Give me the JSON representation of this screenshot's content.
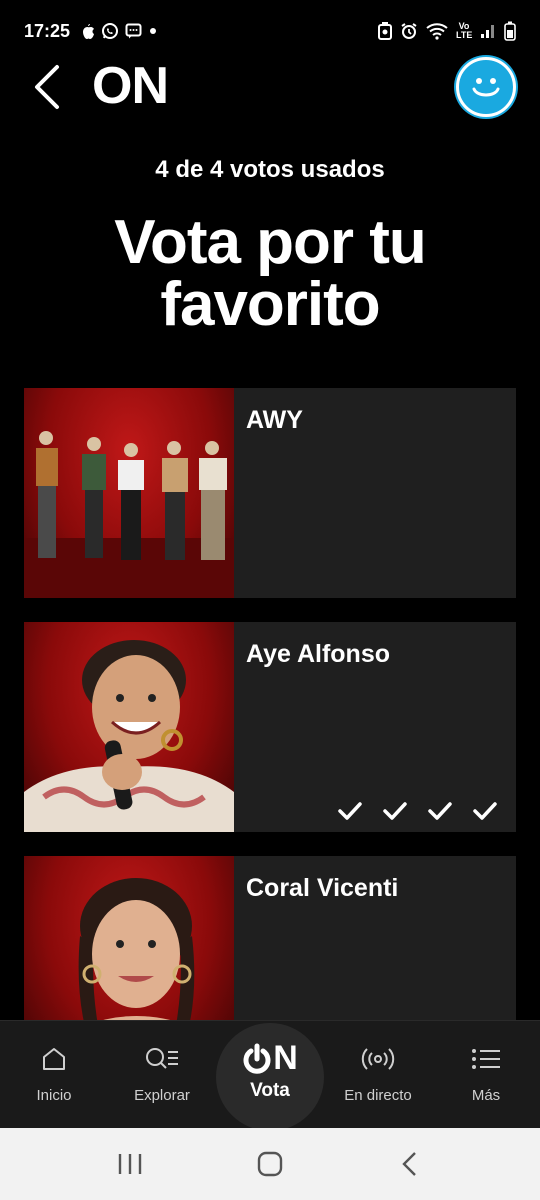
{
  "status_bar": {
    "time": "17:25",
    "left_icons": [
      "apple-icon",
      "whatsapp-icon",
      "message-icon",
      "dot-icon"
    ],
    "right_icons": [
      "battery-saver-icon",
      "alarm-icon",
      "wifi-icon",
      "volte-icon",
      "signal-icon",
      "battery-icon"
    ],
    "volte_text": "Vo LTE"
  },
  "header": {
    "title": "ON",
    "back_icon": "chevron-left-icon",
    "avatar_icon": "smiley-icon",
    "accent": "#1aa9e0"
  },
  "main": {
    "votes_used": "4 de 4 votos usados",
    "headline": "Vota por tu favorito",
    "cards": [
      {
        "name": "AWY",
        "votes": 0
      },
      {
        "name": "Aye Alfonso",
        "votes": 4
      },
      {
        "name": "Coral Vicenti",
        "votes": 0
      }
    ]
  },
  "bottom_nav": {
    "items": [
      {
        "label": "Inicio",
        "icon": "home-icon"
      },
      {
        "label": "Explorar",
        "icon": "search-list-icon"
      },
      {
        "label": "Vota",
        "icon": "on-logo-icon",
        "active": true,
        "logo_text": "ON"
      },
      {
        "label": "En directo",
        "icon": "broadcast-icon"
      },
      {
        "label": "Más",
        "icon": "menu-list-icon"
      }
    ]
  },
  "colors": {
    "background": "#000000",
    "card": "#1f1f1f",
    "photo_red": "#b01010"
  }
}
